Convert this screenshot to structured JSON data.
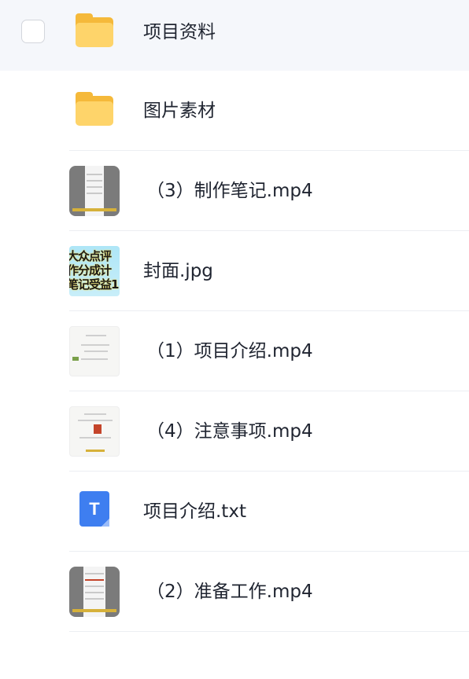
{
  "files": [
    {
      "name": "项目资料",
      "type": "folder",
      "selected": false
    },
    {
      "name": "图片素材",
      "type": "folder"
    },
    {
      "name": "（3）制作笔记.mp4",
      "type": "video"
    },
    {
      "name": "封面.jpg",
      "type": "image",
      "cover_lines": [
        "大众点评",
        "作分成计",
        "笔记受益1"
      ]
    },
    {
      "name": "（1）项目介绍.mp4",
      "type": "video"
    },
    {
      "name": "（4）注意事项.mp4",
      "type": "video"
    },
    {
      "name": "项目介绍.txt",
      "type": "text",
      "icon_letter": "T"
    },
    {
      "name": "（2）准备工作.mp4",
      "type": "video"
    }
  ],
  "colors": {
    "folder": "#fed46a",
    "txt_icon": "#3e7ef0",
    "selected_row_bg": "#f5f7fb",
    "divider": "#eceef2"
  }
}
